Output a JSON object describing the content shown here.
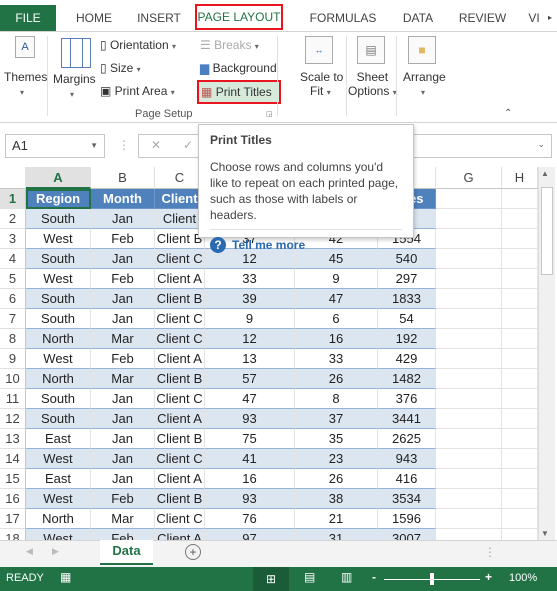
{
  "ribbon_tabs": [
    {
      "label": "FILE"
    },
    {
      "label": "HOME"
    },
    {
      "label": "INSERT"
    },
    {
      "label": "PAGE LAYOUT",
      "active": true
    },
    {
      "label": "FORMULAS"
    },
    {
      "label": "DATA"
    },
    {
      "label": "REVIEW"
    },
    {
      "label": "VI"
    }
  ],
  "ribbon": {
    "themes": "Themes",
    "margins": "Margins",
    "orientation": "Orientation",
    "size": "Size",
    "print_area": "Print Area",
    "breaks": "Breaks",
    "background": "Background",
    "print_titles": "Print Titles",
    "group_page_setup": "Page Setup",
    "scale_to_fit_1": "Scale to",
    "scale_to_fit_2": "Fit",
    "sheet_options_1": "Sheet",
    "sheet_options_2": "Options",
    "arrange": "Arrange"
  },
  "formula_bar": {
    "name_box": "A1",
    "formula": ""
  },
  "tooltip": {
    "title": "Print Titles",
    "body": "Choose rows and columns you'd like to repeat on each printed page, such as those with labels or headers.",
    "link": "Tell me more"
  },
  "columns": [
    "A",
    "B",
    "C",
    "D",
    "E",
    "F",
    "G",
    "H"
  ],
  "headers": [
    "Region",
    "Month",
    "Client",
    "",
    "",
    "Sales"
  ],
  "rows": [
    [
      "South",
      "Jan",
      "Client",
      "",
      "",
      "5"
    ],
    [
      "West",
      "Feb",
      "Client B",
      "37",
      "42",
      "1554"
    ],
    [
      "South",
      "Jan",
      "Client C",
      "12",
      "45",
      "540"
    ],
    [
      "West",
      "Feb",
      "Client A",
      "33",
      "9",
      "297"
    ],
    [
      "South",
      "Jan",
      "Client B",
      "39",
      "47",
      "1833"
    ],
    [
      "South",
      "Jan",
      "Client C",
      "9",
      "6",
      "54"
    ],
    [
      "North",
      "Mar",
      "Client C",
      "12",
      "16",
      "192"
    ],
    [
      "West",
      "Feb",
      "Client A",
      "13",
      "33",
      "429"
    ],
    [
      "North",
      "Mar",
      "Client B",
      "57",
      "26",
      "1482"
    ],
    [
      "South",
      "Jan",
      "Client C",
      "47",
      "8",
      "376"
    ],
    [
      "South",
      "Jan",
      "Client A",
      "93",
      "37",
      "3441"
    ],
    [
      "East",
      "Jan",
      "Client B",
      "75",
      "35",
      "2625"
    ],
    [
      "West",
      "Jan",
      "Client C",
      "41",
      "23",
      "943"
    ],
    [
      "East",
      "Jan",
      "Client A",
      "16",
      "26",
      "416"
    ],
    [
      "West",
      "Feb",
      "Client B",
      "93",
      "38",
      "3534"
    ],
    [
      "North",
      "Mar",
      "Client C",
      "76",
      "21",
      "1596"
    ],
    [
      "West",
      "Feb",
      "Client A",
      "97",
      "31",
      "3007"
    ]
  ],
  "sheet_tabs": [
    {
      "label": "Data",
      "active": true
    }
  ],
  "status": {
    "mode": "READY",
    "zoom": "100%",
    "zoom_level_percent": 100
  },
  "colors": {
    "accent": "#217346",
    "highlight_box": "#e8141f",
    "table_header": "#4f81bd",
    "band": "#dce6f1"
  }
}
